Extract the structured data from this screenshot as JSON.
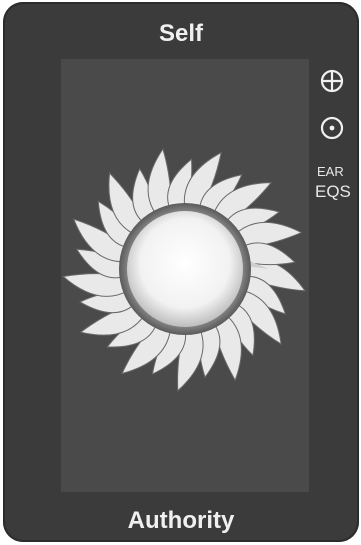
{
  "card": {
    "title": "Self",
    "subtitle": "Authority"
  },
  "side": {
    "crosshair_icon": "crosshair-icon",
    "center_dot_icon": "target-dot-icon",
    "label_top": "EAR",
    "label_bottom": "EQS"
  },
  "colors": {
    "card_bg": "#3b3b3b",
    "panel_bg": "#4a4a4a",
    "text": "#f0f0f0",
    "sun_core": "#f4f4f4"
  }
}
